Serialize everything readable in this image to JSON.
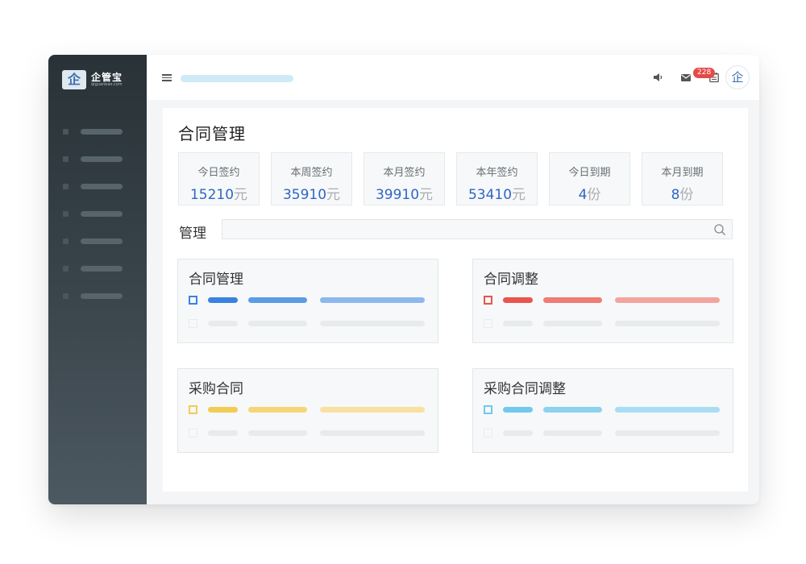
{
  "app": {
    "logo_name": "企管宝",
    "logo_sub": "qiguanbao.com",
    "logo_mark_char": "企"
  },
  "topbar": {
    "icons": [
      "speaker-icon",
      "mail-icon",
      "calendar-icon",
      "list-icon"
    ],
    "badge_count": "228",
    "avatar_char": "企"
  },
  "page": {
    "title": "合同管理"
  },
  "stats": [
    {
      "label": "今日签约",
      "value": "15210",
      "unit": "元"
    },
    {
      "label": "本周签约",
      "value": "35910",
      "unit": "元"
    },
    {
      "label": "本月签约",
      "value": "39910",
      "unit": "元"
    },
    {
      "label": "本年签约",
      "value": "53410",
      "unit": "元"
    },
    {
      "label": "今日到期",
      "value": "4",
      "unit": "份"
    },
    {
      "label": "本月到期",
      "value": "8",
      "unit": "份"
    }
  ],
  "search": {
    "label": "管理",
    "value": ""
  },
  "cards": [
    {
      "title": "合同管理",
      "accent": "#3a82e0",
      "light": "#8db8ee",
      "mid": "#5c9be6"
    },
    {
      "title": "合同调整",
      "accent": "#e8554c",
      "light": "#f2a59f",
      "mid": "#ee7d75"
    },
    {
      "title": "采购合同",
      "accent": "#f2cc54",
      "light": "#f8e1a0",
      "mid": "#f5d677"
    },
    {
      "title": "采购合同调整",
      "accent": "#72c9ec",
      "light": "#a9ddf3",
      "mid": "#8cd3f0"
    }
  ]
}
